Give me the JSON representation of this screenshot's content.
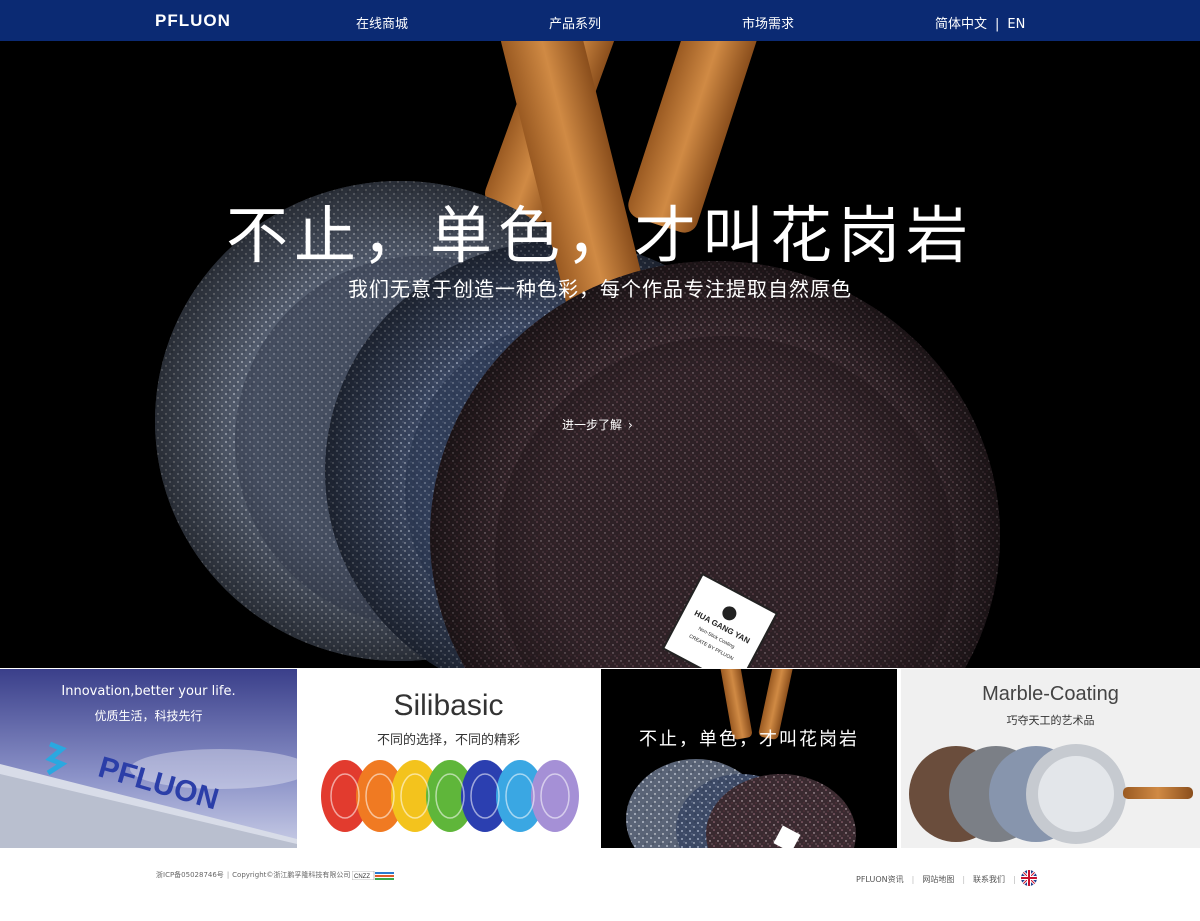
{
  "header": {
    "logo": "PFLUON",
    "nav": [
      "在线商城",
      "产品系列",
      "市场需求"
    ],
    "lang_cn": "简体中文",
    "lang_sep": "|",
    "lang_en": "EN"
  },
  "hero": {
    "title": "不止，单色，才叫花岗岩",
    "subtitle": "我们无意于创造一种色彩，每个作品专注提取自然原色",
    "more": "进一步了解",
    "more_icon": "chevron-right-icon",
    "badge_lines": [
      "HUA GANG YAN",
      "Non-Stick Coating",
      "CREATE BY PFLUON"
    ]
  },
  "tiles": [
    {
      "heading": "Innovation,better your life.",
      "sub": "优质生活，科技先行",
      "sign": "PFLUON"
    },
    {
      "heading": "Silibasic",
      "sub": "不同的选择，不同的精彩"
    },
    {
      "heading": "不止，单色，才叫花岗岩"
    },
    {
      "heading": "Marble-Coating",
      "sub": "巧夺天工的艺术品"
    }
  ],
  "footer": {
    "icp": "浙ICP备05028746号",
    "sep": "|",
    "copyright": "Copyright©浙江鹏孚隆科技有限公司",
    "badge": "CNZZ",
    "links": [
      "PFLUON资讯",
      "网站地图",
      "联系我们"
    ],
    "flag_icon": "uk-flag-icon"
  },
  "colors": {
    "header_bg": "#0b2a73",
    "hero_bg": "#000000",
    "handle": "#c47a37"
  }
}
